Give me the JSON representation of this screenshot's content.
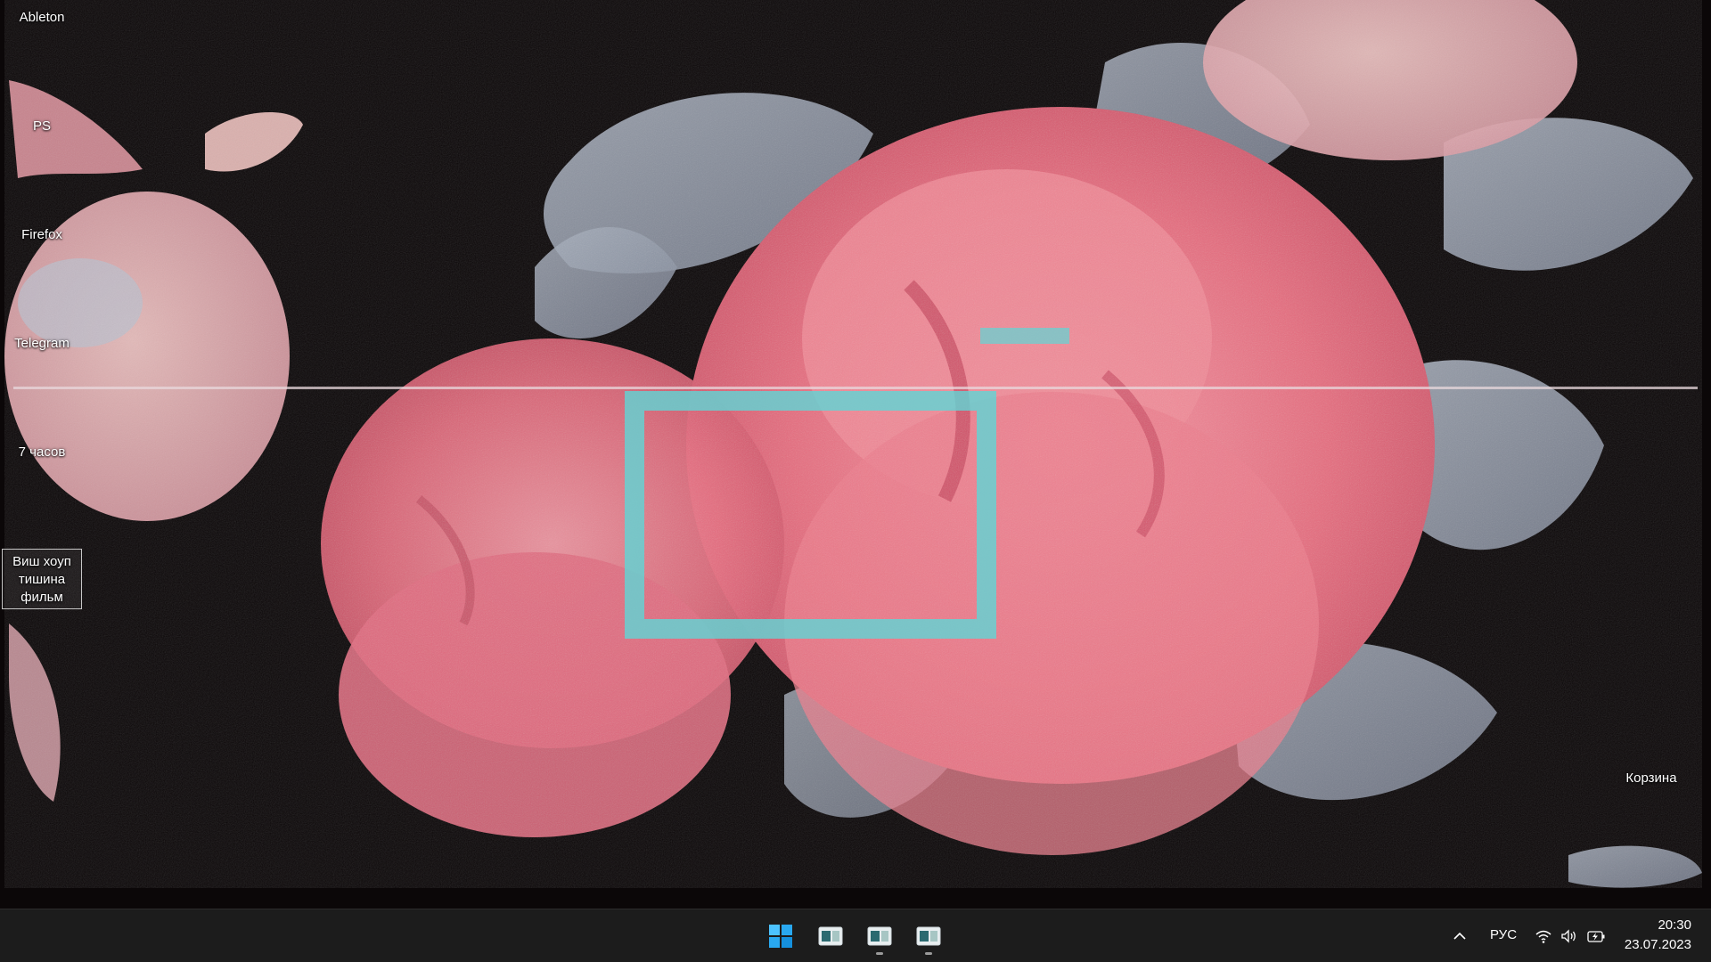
{
  "desktop": {
    "icons": [
      {
        "label": "Ableton"
      },
      {
        "label": "PS"
      },
      {
        "label": "Firefox"
      },
      {
        "label": "Telegram"
      },
      {
        "label": "7 часов"
      },
      {
        "label": "Виш хоуп тишина фильм",
        "selected": true
      },
      {
        "label": "Корзина"
      }
    ]
  },
  "taskbar": {
    "start_icon": "windows-logo-icon",
    "apps": [
      {
        "icon": "app-window-icon",
        "running": false
      },
      {
        "icon": "app-window-icon",
        "running": true
      },
      {
        "icon": "app-window-icon",
        "running": true
      }
    ],
    "tray": {
      "overflow_icon": "chevron-up-icon",
      "language": "РУС",
      "icons": [
        "wifi-icon",
        "volume-icon",
        "battery-charging-icon"
      ]
    },
    "clock": {
      "time": "20:30",
      "date": "23.07.2023"
    }
  },
  "colors": {
    "taskbar_bg": "#1c1c1c",
    "accent": "#2fb3ff",
    "wallpaper_bg": "#0b0708",
    "rose": "#e8667a",
    "leaf": "#8f98a8"
  }
}
